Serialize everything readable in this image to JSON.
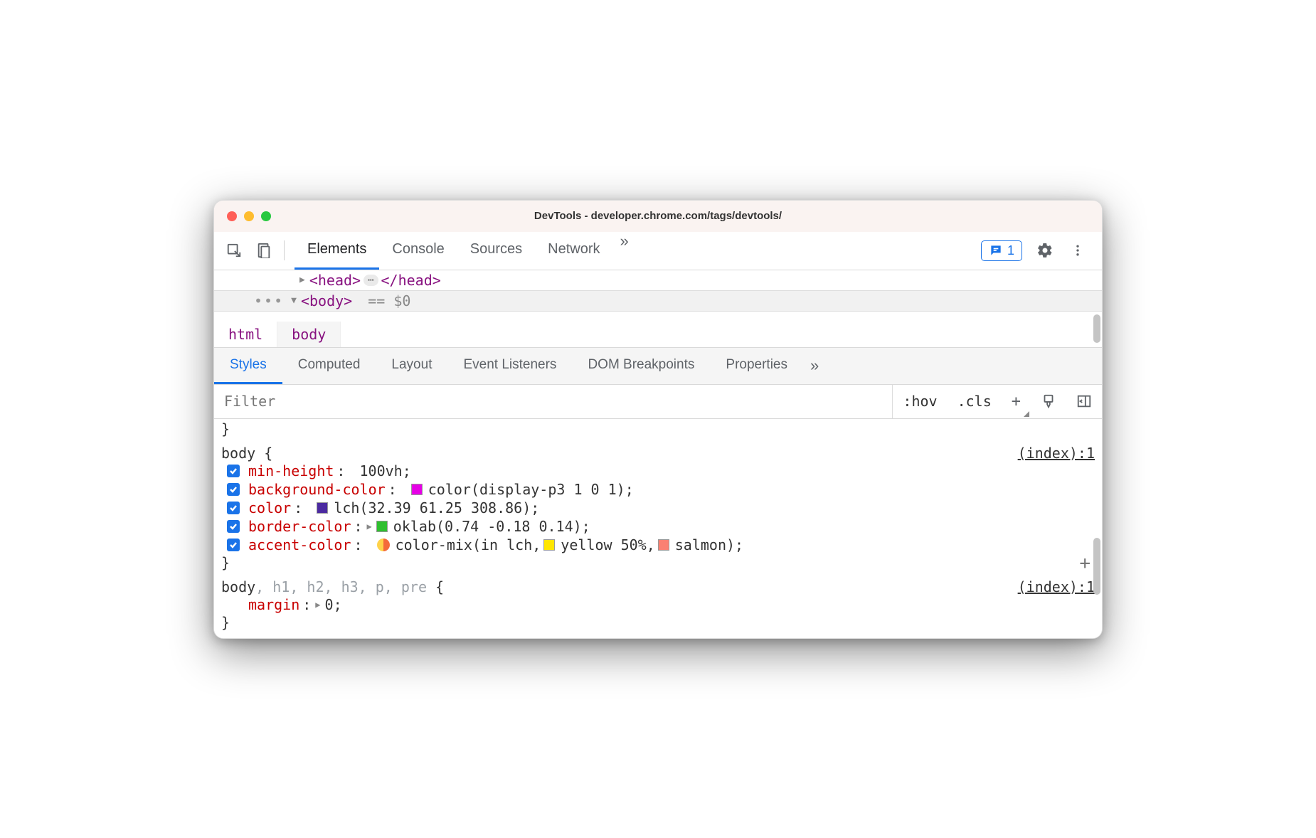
{
  "window": {
    "title": "DevTools - developer.chrome.com/tags/devtools/"
  },
  "toolbar": {
    "tabs": [
      "Elements",
      "Console",
      "Sources",
      "Network"
    ],
    "active_tab": "Elements",
    "overflow_glyph": "»",
    "issues_count": "1"
  },
  "dom": {
    "head_open": "<head>",
    "head_close": "</head>",
    "body_open": "<body>",
    "eq_dollar": "== $0",
    "dots": "•••",
    "ellipsis": "⋯"
  },
  "breadcrumb": {
    "items": [
      "html",
      "body"
    ],
    "active": "body"
  },
  "subtabs": {
    "items": [
      "Styles",
      "Computed",
      "Layout",
      "Event Listeners",
      "DOM Breakpoints",
      "Properties"
    ],
    "active": "Styles",
    "overflow_glyph": "»"
  },
  "styles_toolbar": {
    "filter_placeholder": "Filter",
    "hov": ":hov",
    "cls": ".cls",
    "plus": "+"
  },
  "rules": {
    "end_brace_top": "}",
    "rule1": {
      "selector": "body {",
      "source": "(index):1",
      "decls": [
        {
          "prop": "min-height",
          "value": "100vh;",
          "swatch": null,
          "expand": false
        },
        {
          "prop": "background-color",
          "value": "color(display-p3 1 0 1);",
          "swatch": "#e600e6",
          "expand": false
        },
        {
          "prop": "color",
          "value": "lch(32.39 61.25 308.86);",
          "swatch": "#4b2aa0",
          "expand": false
        },
        {
          "prop": "border-color",
          "value": "oklab(0.74 -0.18 0.14);",
          "swatch": "#2fbf2f",
          "expand": true
        },
        {
          "prop": "accent-color",
          "value_prefix": "color-mix(in lch, ",
          "mix": true,
          "mix_a_swatch": "#ffe600",
          "mix_a_text": "yellow 50%, ",
          "mix_b_swatch": "#fa8072",
          "mix_b_text": "salmon);"
        }
      ],
      "close": "}"
    },
    "rule2": {
      "selector_main": "body",
      "selector_dim": ", h1, h2, h3, p, pre",
      "selector_brace": " {",
      "source": "(index):1",
      "decl": {
        "prop": "margin",
        "value": "0;",
        "expand": true
      },
      "close": "}"
    }
  }
}
